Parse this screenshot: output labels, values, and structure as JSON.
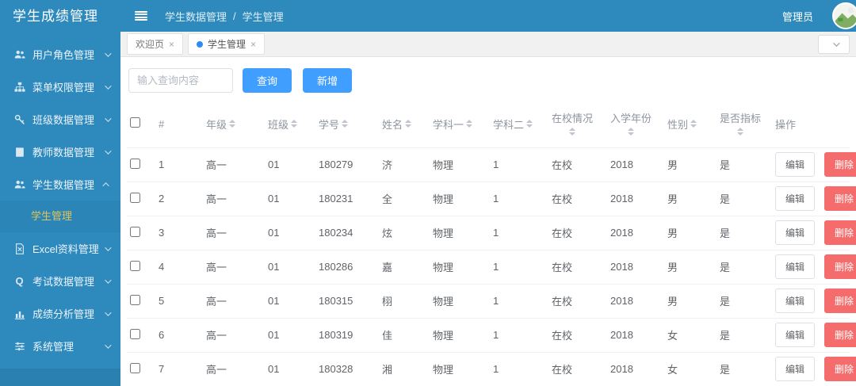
{
  "app_title": "学生成绩管理",
  "colors": {
    "sidebar_blue": "#2e8abd",
    "primary_blue": "#409eff",
    "danger_red": "#f56c6c",
    "active_menu_yellow": "#e0c35c",
    "active_tab_dot": "#2d8cf0"
  },
  "sidebar": {
    "items": [
      {
        "label": "用户角色管理",
        "icon": "users-icon",
        "expanded": false
      },
      {
        "label": "菜单权限管理",
        "icon": "sitemap-icon",
        "expanded": false
      },
      {
        "label": "班级数据管理",
        "icon": "key-icon",
        "expanded": false
      },
      {
        "label": "教师数据管理",
        "icon": "book-icon",
        "expanded": false
      },
      {
        "label": "学生数据管理",
        "icon": "users-icon",
        "expanded": true,
        "children": [
          {
            "label": "学生管理",
            "active": true
          }
        ]
      },
      {
        "label": "Excel资料管理",
        "icon": "file-excel-icon",
        "expanded": false
      },
      {
        "label": "考试数据管理",
        "icon": "q-icon",
        "expanded": false
      },
      {
        "label": "成绩分析管理",
        "icon": "bar-chart-icon",
        "expanded": false
      },
      {
        "label": "系统管理",
        "icon": "sliders-icon",
        "expanded": false
      }
    ]
  },
  "header": {
    "breadcrumb": [
      "学生数据管理",
      "学生管理"
    ],
    "breadcrumb_separator": "/",
    "user": "管理员"
  },
  "tabs": [
    {
      "label": "欢迎页",
      "active": false
    },
    {
      "label": "学生管理",
      "active": true
    }
  ],
  "toolbar": {
    "search_placeholder": "输入查询内容",
    "query_label": "查询",
    "add_label": "新增"
  },
  "table": {
    "columns": [
      {
        "key": "index",
        "label": "#",
        "sortable": false,
        "wrap": false
      },
      {
        "key": "grade",
        "label": "年级",
        "sortable": true,
        "wrap": false
      },
      {
        "key": "class_no",
        "label": "班级",
        "sortable": true,
        "wrap": false
      },
      {
        "key": "student_no",
        "label": "学号",
        "sortable": true,
        "wrap": false
      },
      {
        "key": "name",
        "label": "姓名",
        "sortable": true,
        "wrap": false
      },
      {
        "key": "subject1",
        "label": "学科一",
        "sortable": true,
        "wrap": false
      },
      {
        "key": "subject2",
        "label": "学科二",
        "sortable": true,
        "wrap": false
      },
      {
        "key": "school_status",
        "label": "在校情况",
        "sortable": true,
        "wrap": true
      },
      {
        "key": "enroll_year",
        "label": "入学年份",
        "sortable": true,
        "wrap": true
      },
      {
        "key": "gender",
        "label": "性别",
        "sortable": true,
        "wrap": false
      },
      {
        "key": "indicator",
        "label": "是否指标",
        "sortable": true,
        "wrap": true
      },
      {
        "key": "actions",
        "label": "操作",
        "sortable": false,
        "wrap": false
      }
    ],
    "rows": [
      {
        "index": "1",
        "grade": "高一",
        "class_no": "01",
        "student_no": "180279",
        "name": "济",
        "subject1": "物理",
        "subject2": "1",
        "school_status": "在校",
        "enroll_year": "2018",
        "gender": "男",
        "indicator": "是"
      },
      {
        "index": "2",
        "grade": "高一",
        "class_no": "01",
        "student_no": "180231",
        "name": "全",
        "subject1": "物理",
        "subject2": "1",
        "school_status": "在校",
        "enroll_year": "2018",
        "gender": "男",
        "indicator": "是"
      },
      {
        "index": "3",
        "grade": "高一",
        "class_no": "01",
        "student_no": "180234",
        "name": "炫",
        "subject1": "物理",
        "subject2": "1",
        "school_status": "在校",
        "enroll_year": "2018",
        "gender": "男",
        "indicator": "是"
      },
      {
        "index": "4",
        "grade": "高一",
        "class_no": "01",
        "student_no": "180286",
        "name": "嘉",
        "subject1": "物理",
        "subject2": "1",
        "school_status": "在校",
        "enroll_year": "2018",
        "gender": "男",
        "indicator": "是"
      },
      {
        "index": "5",
        "grade": "高一",
        "class_no": "01",
        "student_no": "180315",
        "name": "栩",
        "subject1": "物理",
        "subject2": "1",
        "school_status": "在校",
        "enroll_year": "2018",
        "gender": "男",
        "indicator": "是"
      },
      {
        "index": "6",
        "grade": "高一",
        "class_no": "01",
        "student_no": "180319",
        "name": "佳",
        "subject1": "物理",
        "subject2": "1",
        "school_status": "在校",
        "enroll_year": "2018",
        "gender": "女",
        "indicator": "是"
      },
      {
        "index": "7",
        "grade": "高一",
        "class_no": "01",
        "student_no": "180328",
        "name": "湘",
        "subject1": "物理",
        "subject2": "1",
        "school_status": "在校",
        "enroll_year": "2018",
        "gender": "女",
        "indicator": "是"
      }
    ],
    "edit_label": "编辑",
    "delete_label": "删除"
  }
}
